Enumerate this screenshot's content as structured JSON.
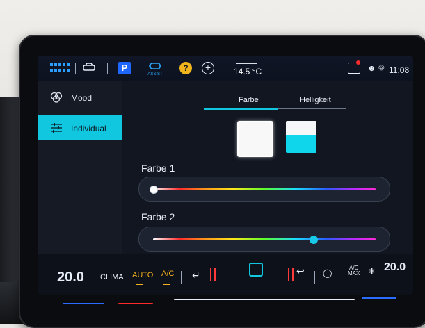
{
  "statusbar": {
    "temperature": "14.5 °C",
    "time": "11:08",
    "parking_label": "P",
    "assist_label": "ASSIST",
    "help_label": "?"
  },
  "sidebar": {
    "items": [
      {
        "label": "Mood",
        "icon": "mood-icon",
        "active": false
      },
      {
        "label": "Individual",
        "icon": "sliders-icon",
        "active": true
      }
    ]
  },
  "main": {
    "tabs": [
      {
        "label": "Farbe",
        "active": true
      },
      {
        "label": "Helligkeit",
        "active": false
      }
    ],
    "color1_label": "Farbe 1",
    "color2_label": "Farbe 2",
    "color1_slider_position": 0.0,
    "color2_slider_position": 0.72
  },
  "climate": {
    "temp_left": "20.0",
    "clima_label": "CLIMA",
    "auto_label": "AUTO",
    "ac_label": "A/C",
    "acmax_label_top": "A/C",
    "acmax_label_bottom": "MAX",
    "temp_right": "20.0"
  },
  "colors": {
    "accent": "#11c7e0",
    "amber": "#f5b21e",
    "heat": "#ff3a3a",
    "brand_blue": "#1f66ff"
  }
}
